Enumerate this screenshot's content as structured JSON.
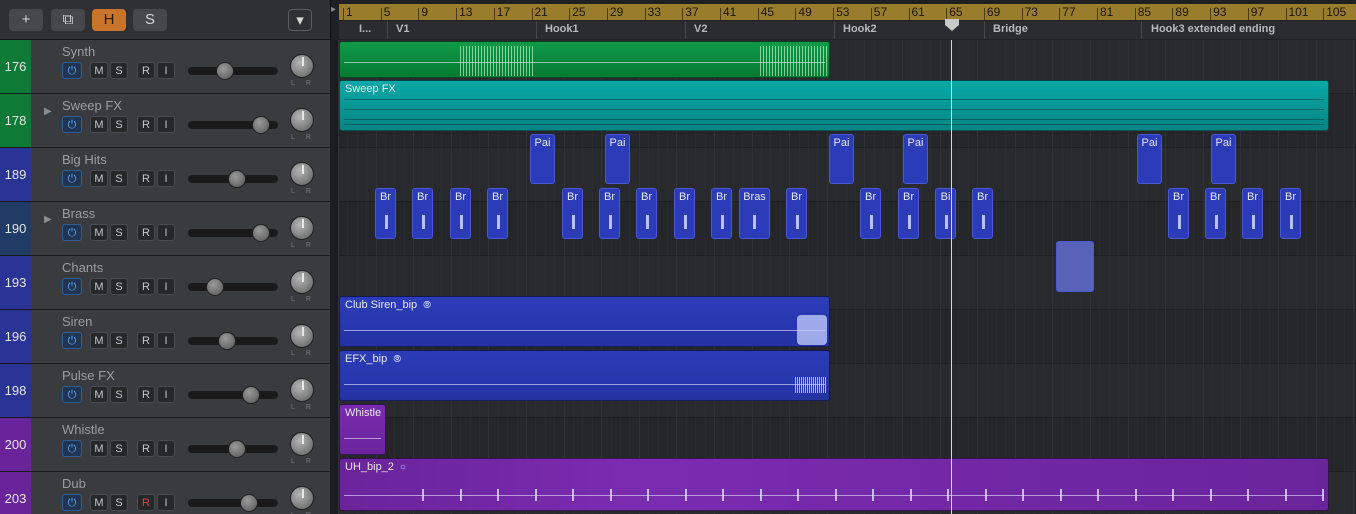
{
  "header": {
    "add_icon": "+",
    "dup_icon": "⧉",
    "h_label": "H",
    "s_label": "S",
    "filter_icon": "▾"
  },
  "ruler": {
    "bars": [
      "1",
      "5",
      "9",
      "13",
      "17",
      "21",
      "25",
      "29",
      "33",
      "37",
      "41",
      "45",
      "49",
      "53",
      "57",
      "61",
      "65",
      "69",
      "73",
      "77",
      "81",
      "85",
      "89",
      "93",
      "97",
      "101",
      "105"
    ],
    "markers": [
      "I...",
      "V1",
      "Hook1",
      "V2",
      "Hook2",
      "Bridge",
      "Hook3 extended ending"
    ]
  },
  "tracks": [
    {
      "num": "176",
      "name": "Synth",
      "color": "#0d7a35"
    },
    {
      "num": "178",
      "name": "Sweep FX",
      "color": "#0d7a35"
    },
    {
      "num": "189",
      "name": "Big Hits",
      "color": "#2a3396"
    },
    {
      "num": "190",
      "name": "Brass",
      "color": "#1f3b66"
    },
    {
      "num": "193",
      "name": "Chants",
      "color": "#2a3396"
    },
    {
      "num": "196",
      "name": "Siren",
      "color": "#2a3396"
    },
    {
      "num": "198",
      "name": "Pulse FX",
      "color": "#2a3396"
    },
    {
      "num": "200",
      "name": "Whistle",
      "color": "#6a249b"
    },
    {
      "num": "203",
      "name": "Dub",
      "color": "#6a249b"
    }
  ],
  "track_buttons": {
    "m": "M",
    "s": "S",
    "r": "R",
    "i": "I"
  },
  "regions": {
    "sweep": "Sweep FX",
    "bighits": "Pai",
    "brass_short": "Br",
    "brass_long": "Bras",
    "brass_cut": "Bi",
    "siren": "Club Siren_bip",
    "pulse": "EFX_bip",
    "whistle": "Whistle",
    "dub": "UH_bip_2"
  }
}
